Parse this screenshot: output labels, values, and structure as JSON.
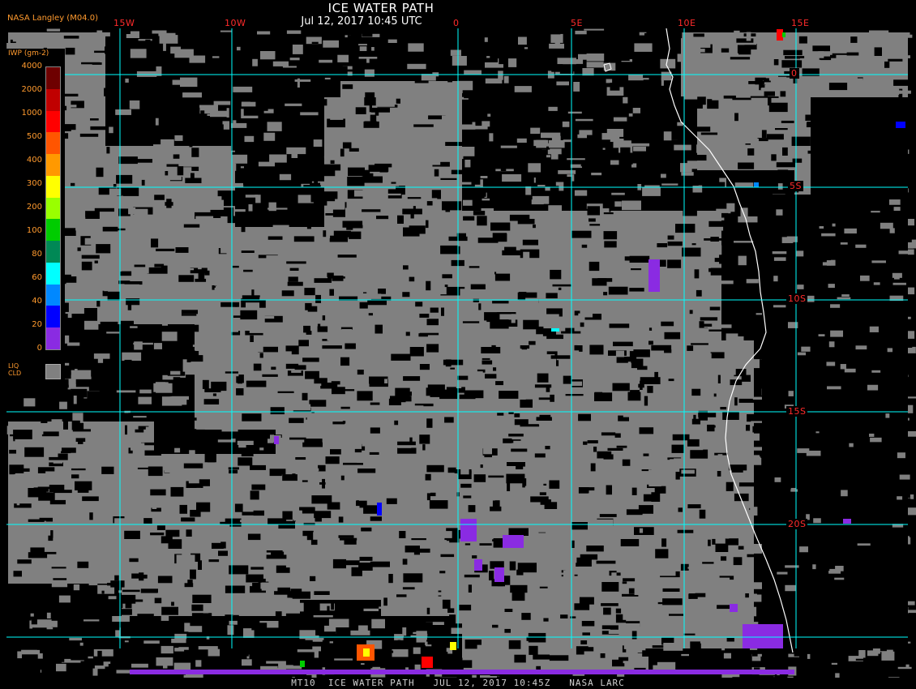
{
  "header": {
    "title": "ICE WATER PATH",
    "subtitle": "Jul 12, 2017 10:45 UTC",
    "credit": "NASA Langley (M04.0)"
  },
  "map": {
    "lon_labels": [
      "15W",
      "10W",
      "0",
      "5E",
      "10E",
      "15E"
    ],
    "lat_labels": [
      "0",
      "5S",
      "10S",
      "15S",
      "20S"
    ],
    "grid_color": "#00ffff",
    "label_color": "#ff2b2b",
    "cloud_color": "#808080",
    "coast_color": "#ffffff"
  },
  "legend": {
    "title": "IWP (gm-2)",
    "ticks": [
      "4000",
      "2000",
      "1000",
      "500",
      "400",
      "300",
      "200",
      "100",
      "80",
      "60",
      "40",
      "20",
      "0"
    ],
    "colors": [
      "#6e0000",
      "#c00000",
      "#ff0000",
      "#ff5500",
      "#ff9900",
      "#ffff00",
      "#99ff00",
      "#00cc00",
      "#008855",
      "#00ffff",
      "#0088ff",
      "#0000ff",
      "#8a2be2"
    ],
    "liq_label_1": "LIQ",
    "liq_label_2": "CLD",
    "liq_color": "#808080"
  },
  "footer": {
    "text": "MT10  ICE WATER PATH   JUL 12, 2017 10:45Z   NASA LARC"
  }
}
